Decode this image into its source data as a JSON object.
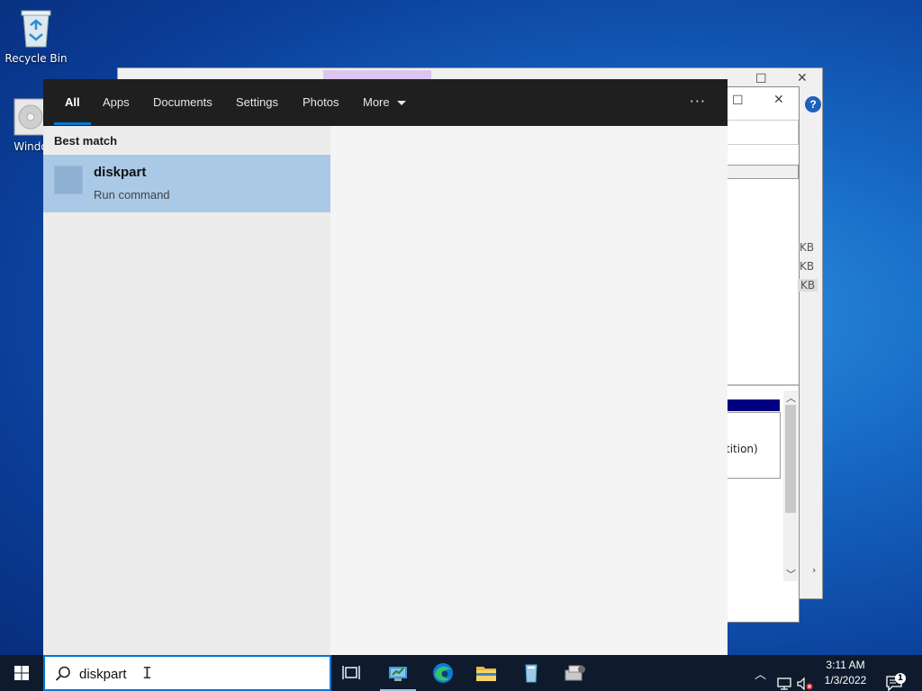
{
  "desktop": {
    "icons": [
      {
        "label": "Recycle Bin"
      },
      {
        "label": "Windo"
      }
    ]
  },
  "background_window": {
    "size_labels": [
      "KB",
      "KB",
      "KB"
    ],
    "partition_text": "tition)"
  },
  "search_panel": {
    "tabs": [
      {
        "label": "All"
      },
      {
        "label": "Apps"
      },
      {
        "label": "Documents"
      },
      {
        "label": "Settings"
      },
      {
        "label": "Photos"
      },
      {
        "label": "More"
      }
    ],
    "active_tab": "All",
    "options_icon": "ellipsis-icon",
    "best_match_title": "Best match",
    "best_match": {
      "title": "diskpart",
      "subtitle": "Run command"
    }
  },
  "taskbar": {
    "search_value": "diskpart",
    "apps": [
      "task-view-icon",
      "server-manager-icon",
      "edge-icon",
      "file-explorer-icon",
      "drive-icon",
      "setup-icon"
    ],
    "clock": {
      "time": "3:11 AM",
      "date": "1/3/2022"
    },
    "notification_count": "1"
  },
  "colors": {
    "accent": "#0078d7",
    "panel_header": "#1f1f1f",
    "selected_result": "#a9c9e6"
  }
}
